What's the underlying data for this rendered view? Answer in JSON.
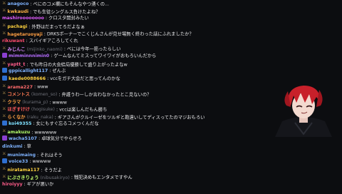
{
  "chat": {
    "messages": [
      {
        "badge": "sword",
        "user": "anagoco",
        "user_color": "#7fb3ff",
        "sub": "",
        "text": "べにのコメ欄にもそんなやつ湧くの..."
      },
      {
        "badge": "sword",
        "user": "kwkaudi",
        "user_color": "#ffb347",
        "sub": "",
        "text": "でも生徒シングルス負けたよね？"
      },
      {
        "badge": "",
        "user": "mashiroooooooo",
        "user_color": "#e05cff",
        "sub": "",
        "text": "クロスタ開封みたい"
      },
      {
        "badge": "sword",
        "user": "pachagi",
        "user_color": "#ffd23f",
        "sub": "",
        "text": "外野はだまってろだよなぁ"
      },
      {
        "badge": "sword",
        "user": "hagetaruoyaji",
        "user_color": "#ff9f43",
        "sub": "",
        "text": "DRKSボーナーでこくじんさんが見せ場無く終わった話にふれましたか？"
      },
      {
        "badge": "",
        "user": "rikuwant",
        "user_color": "#ff4d6d",
        "sub": "",
        "text": "スバイギアころしてくれ"
      },
      {
        "badge": "sword",
        "user": "みじんこ",
        "user_color": "#d98cff",
        "sub": "(mijinko_naomi)",
        "text": "べには今年一筋ったらしい"
      },
      {
        "badge": "purple",
        "user": "mimminnnimin0",
        "user_color": "#b66dff",
        "sub": "",
        "text": "ゲームなんてミスってワイワイがおもろいんだから"
      },
      {
        "badge": "sword",
        "user": "yaptt_t",
        "user_color": "#ff5c8a",
        "sub": "",
        "text": "でも昨日の大会結局優勝して盛り上がったよなw"
      },
      {
        "badge": "blue",
        "user": "gppicallight117",
        "user_color": "#7fb3ff",
        "sub": "",
        "text": "ぜんぶ"
      },
      {
        "badge": "blue",
        "user": "kaede0088666",
        "user_color": "#ffd23f",
        "sub": "",
        "text": "vccをガチ大会だと思ってんのかな"
      },
      {
        "badge": "sword",
        "user": "arama227",
        "user_color": "#ff6b6b",
        "sub": "",
        "text": "www"
      },
      {
        "badge": "sword",
        "user": "コメントス",
        "user_color": "#ff7b54",
        "sub": "(komen_so)",
        "text": "弁護うわーしか言わなかったとこ見ないの？"
      },
      {
        "badge": "sword",
        "user": "クラマ",
        "user_color": "#ff9f43",
        "sub": "(kurama_p)",
        "text": "wwww"
      },
      {
        "badge": "sword",
        "user": "ほぎすけけ",
        "user_color": "#ff5c5c",
        "sub": "(hogisuke)",
        "text": "vccは楽しんだもん勝ち"
      },
      {
        "badge": "sword",
        "user": "らくなか",
        "user_color": "#ff9f43",
        "sub": "(raku_naka)",
        "text": "ギアさんがクルイーゼをツルギと勘違いしてディスってたのマジおもろい"
      },
      {
        "badge": "blue",
        "user": "koi49355",
        "user_color": "#7fe0ff",
        "sub": "",
        "text": "女にもすぐ忘るコメつくんだな"
      },
      {
        "badge": "sword",
        "user": "amakuzu",
        "user_color": "#b4ff6b",
        "sub": "",
        "text": "wwwwww"
      },
      {
        "badge": "purple",
        "user": "wacha5107",
        "user_color": "#7fb3ff",
        "sub": "",
        "text": "卓球気分でやらせろ"
      },
      {
        "badge": "",
        "user": "dinkumi",
        "user_color": "#7fb3ff",
        "sub": "",
        "text": "草"
      },
      {
        "badge": "sword",
        "user": "munimaing",
        "user_color": "#7fb3ff",
        "sub": "",
        "text": "それはそう"
      },
      {
        "badge": "blue",
        "user": "voice33",
        "user_color": "#7fb3ff",
        "sub": "",
        "text": "wwwww"
      },
      {
        "badge": "sword",
        "user": "niratama117",
        "user_color": "#ffd23f",
        "sub": "",
        "text": "そうだよ"
      },
      {
        "badge": "sword",
        "user": "にぶさきりょう",
        "user_color": "#c6ff6b",
        "sub": "(nibusakiryo)",
        "text": "戦犯決めもエンタメですやん"
      },
      {
        "badge": "",
        "user": "hiroiyyy",
        "user_color": "#ff5c8a",
        "sub": "",
        "text": "ギアが悪いか"
      }
    ]
  },
  "avatar": {
    "hair_color": "#c8202a",
    "skin_color": "#f3d9cf"
  }
}
